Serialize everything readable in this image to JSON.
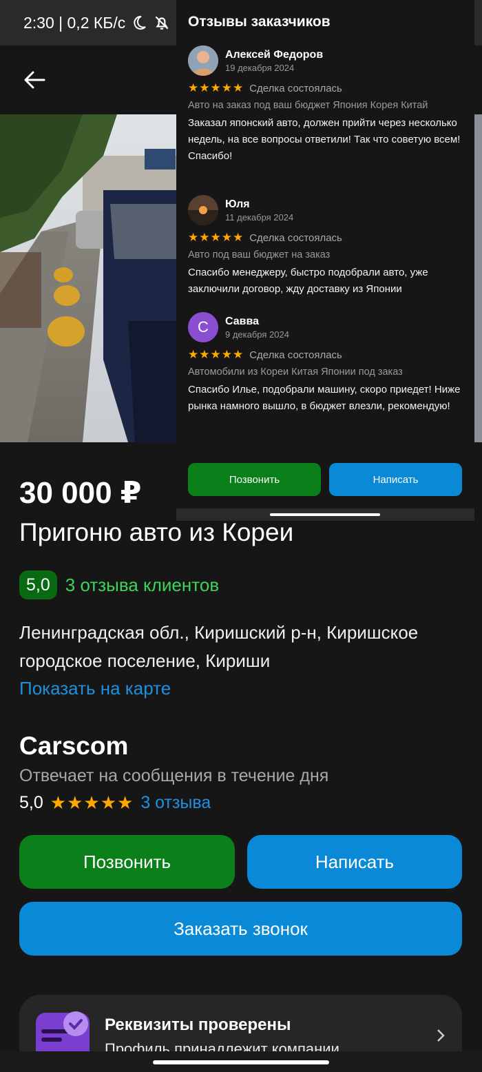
{
  "status_bar": {
    "time_speed": "2:30 | 0,2 КБ/с"
  },
  "listing": {
    "price": "30 000 ₽",
    "title": "Пригоню авто из Кореи",
    "rating_badge": "5,0",
    "reviews_link": "3 отзыва клиентов",
    "address": "Ленинградская обл., Киришский р-н, Киришское городское поселение, Кириши",
    "map_link": "Показать на карте"
  },
  "seller": {
    "name": "Carscom",
    "reply_time": "Отвечает на сообщения в течение дня",
    "rating": "5,0",
    "stars": "★★★★★",
    "reviews_link": "3 отзыва"
  },
  "actions": {
    "call": "Позвонить",
    "write": "Написать",
    "order_call": "Заказать звонок"
  },
  "verified": {
    "title": "Реквизиты проверены",
    "subtitle": "Профиль принадлежит компании"
  },
  "overlay": {
    "title": "Отзывы заказчиков",
    "reviews": [
      {
        "name": "Алексей Федоров",
        "date": "19 декабря 2024",
        "stars": "★★★★★",
        "deal": "Сделка состоялась",
        "item": "Авто на заказ под ваш бюджет Япония Корея Китай",
        "text": "Заказал японский авто, должен прийти через несколько недель, на все вопросы ответили! Так что советую всем! Спасибо!"
      },
      {
        "name": "Юля",
        "date": "11 декабря 2024",
        "stars": "★★★★★",
        "deal": "Сделка состоялась",
        "item": "Авто под ваш бюджет на заказ",
        "text": "Спасибо менеджеру, быстро подобрали авто, уже заключили договор, жду доставку из Японии"
      },
      {
        "name": "Савва",
        "avatar_letter": "С",
        "date": "9 декабря 2024",
        "stars": "★★★★★",
        "deal": "Сделка состоялась",
        "item": "Автомобили из Кореи Китая Японии под заказ",
        "text": "Спасибо Илье, подобрали машину, скоро приедет! Ниже рынка намного вышло, в бюджет влезли, рекомендую!"
      }
    ],
    "call": "Позвонить",
    "write": "Написать"
  },
  "colors": {
    "background": "#161616",
    "green": "#0a7f1a",
    "blue": "#0a8ad6",
    "star": "#ffa800",
    "link": "#1e90e0"
  }
}
